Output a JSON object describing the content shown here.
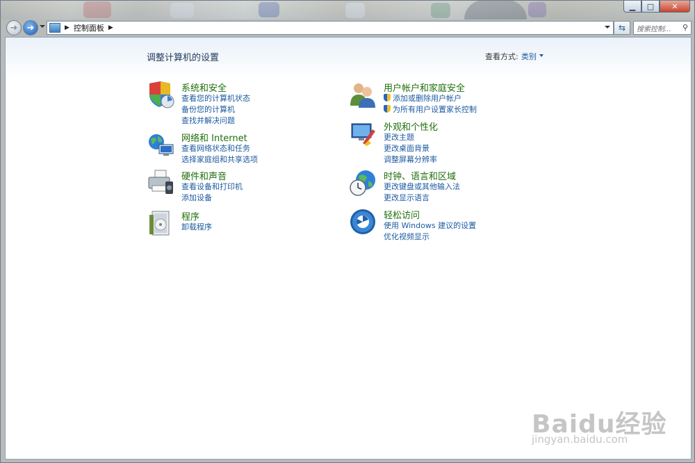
{
  "window": {
    "minimize": "▁",
    "maximize": "□",
    "close": "✕"
  },
  "nav": {
    "breadcrumb": "控制面板",
    "search_placeholder": "搜索控制...",
    "back_icon": "back-arrow-icon",
    "forward_icon": "forward-arrow-icon"
  },
  "main": {
    "title": "调整计算机的设置",
    "view_by_label": "查看方式:",
    "view_by_value": "类别"
  },
  "categories": [
    {
      "title": "系统和安全",
      "icon": "system-security-icon",
      "links": [
        {
          "label": "查看您的计算机状态",
          "shield": false
        },
        {
          "label": "备份您的计算机",
          "shield": false
        },
        {
          "label": "查找并解决问题",
          "shield": false
        }
      ]
    },
    {
      "title": "网络和 Internet",
      "icon": "network-internet-icon",
      "links": [
        {
          "label": "查看网络状态和任务",
          "shield": false
        },
        {
          "label": "选择家庭组和共享选项",
          "shield": false
        }
      ]
    },
    {
      "title": "硬件和声音",
      "icon": "hardware-sound-icon",
      "links": [
        {
          "label": "查看设备和打印机",
          "shield": false
        },
        {
          "label": "添加设备",
          "shield": false
        }
      ]
    },
    {
      "title": "程序",
      "icon": "programs-icon",
      "links": [
        {
          "label": "卸载程序",
          "shield": false
        }
      ]
    },
    {
      "title": "用户帐户和家庭安全",
      "icon": "user-accounts-icon",
      "links": [
        {
          "label": "添加或删除用户帐户",
          "shield": true
        },
        {
          "label": "为所有用户设置家长控制",
          "shield": true
        }
      ]
    },
    {
      "title": "外观和个性化",
      "icon": "appearance-icon",
      "links": [
        {
          "label": "更改主题",
          "shield": false
        },
        {
          "label": "更改桌面背景",
          "shield": false
        },
        {
          "label": "调整屏幕分辨率",
          "shield": false
        }
      ]
    },
    {
      "title": "时钟、语言和区域",
      "icon": "clock-language-region-icon",
      "links": [
        {
          "label": "更改键盘或其他输入法",
          "shield": false
        },
        {
          "label": "更改显示语言",
          "shield": false
        }
      ]
    },
    {
      "title": "轻松访问",
      "icon": "ease-of-access-icon",
      "links": [
        {
          "label": "使用 Windows 建议的设置",
          "shield": false
        },
        {
          "label": "优化视频显示",
          "shield": false
        }
      ]
    }
  ],
  "watermark": {
    "logo": "Baidu经验",
    "url": "jingyan.baidu.com"
  }
}
